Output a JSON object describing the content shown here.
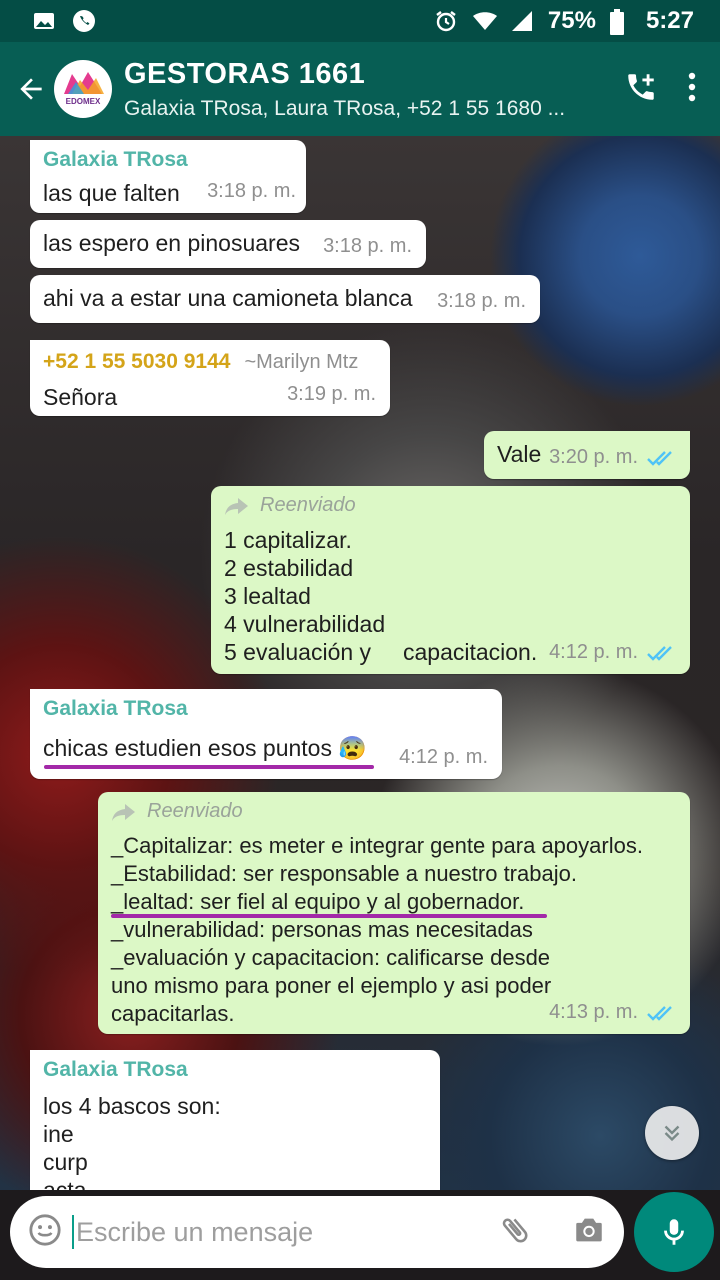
{
  "status_bar": {
    "battery": "75%",
    "time": "5:27",
    "icons": [
      "image-icon",
      "whatsapp-icon",
      "alarm-icon",
      "wifi-icon",
      "signal-icon",
      "battery-icon"
    ]
  },
  "header": {
    "title": "GESTORAS 1661",
    "subtitle": "Galaxia TRosa, Laura TRosa, +52 1 55 1680 ...",
    "avatar_text": "EDOMEX",
    "icons": [
      "back-arrow-icon",
      "add-call-icon",
      "more-vert-icon"
    ]
  },
  "messages": [
    {
      "type": "in",
      "sender": "Galaxia TRosa",
      "lines": [
        "las que falten"
      ],
      "time": "3:18 p. m."
    },
    {
      "type": "in",
      "lines": [
        "las espero en pinosuares"
      ],
      "time": "3:18 p. m."
    },
    {
      "type": "in",
      "lines": [
        "ahi va a estar una camioneta blanca"
      ],
      "time": "3:18 p. m."
    },
    {
      "type": "in",
      "sender": "+52 1 55 5030 9144",
      "sender_alias": "~Marilyn Mtz",
      "lines": [
        "Señora"
      ],
      "time": "3:19 p. m."
    },
    {
      "type": "out",
      "lines": [
        "Vale"
      ],
      "time": "3:20 p. m."
    },
    {
      "type": "out",
      "forwarded": "Reenviado",
      "lines": [
        "1 capitalizar.",
        "2 estabilidad",
        "3 lealtad",
        "4 vulnerabilidad",
        "5 evaluación y     capacitacion."
      ],
      "time": "4:12 p. m."
    },
    {
      "type": "in",
      "sender": "Galaxia TRosa",
      "lines": [
        "chicas estudien esos puntos 😰"
      ],
      "time": "4:12 p. m."
    },
    {
      "type": "out",
      "forwarded": "Reenviado",
      "lines": [
        "_Capitalizar: es meter e integrar gente para apoyarlos.",
        "_Estabilidad: ser responsable a nuestro trabajo.",
        "_lealtad: ser fiel al equipo y al gobernador.",
        "_vulnerabilidad: personas mas necesitadas",
        "_evaluación y capacitacion: calificarse desde",
        "uno mismo para poner el ejemplo y asi poder",
        "capacitarlas."
      ],
      "time": "4:13 p. m."
    },
    {
      "type": "in",
      "sender": "Galaxia TRosa",
      "lines": [
        "los 4 bascos son:",
        "ine",
        "curp",
        "acta"
      ]
    }
  ],
  "colors": {
    "header": "#075e54",
    "status_bar": "#044d45",
    "outgoing": "#dcf8c6",
    "incoming": "#ffffff",
    "sender": "#52b5a8",
    "highlight": "#a329a8",
    "read_ticks": "#4fc3f7"
  },
  "input": {
    "placeholder": "Escribe un mensaje",
    "icons": [
      "emoji-icon",
      "attach-icon",
      "camera-icon",
      "mic-icon",
      "scroll-down-icon"
    ]
  }
}
